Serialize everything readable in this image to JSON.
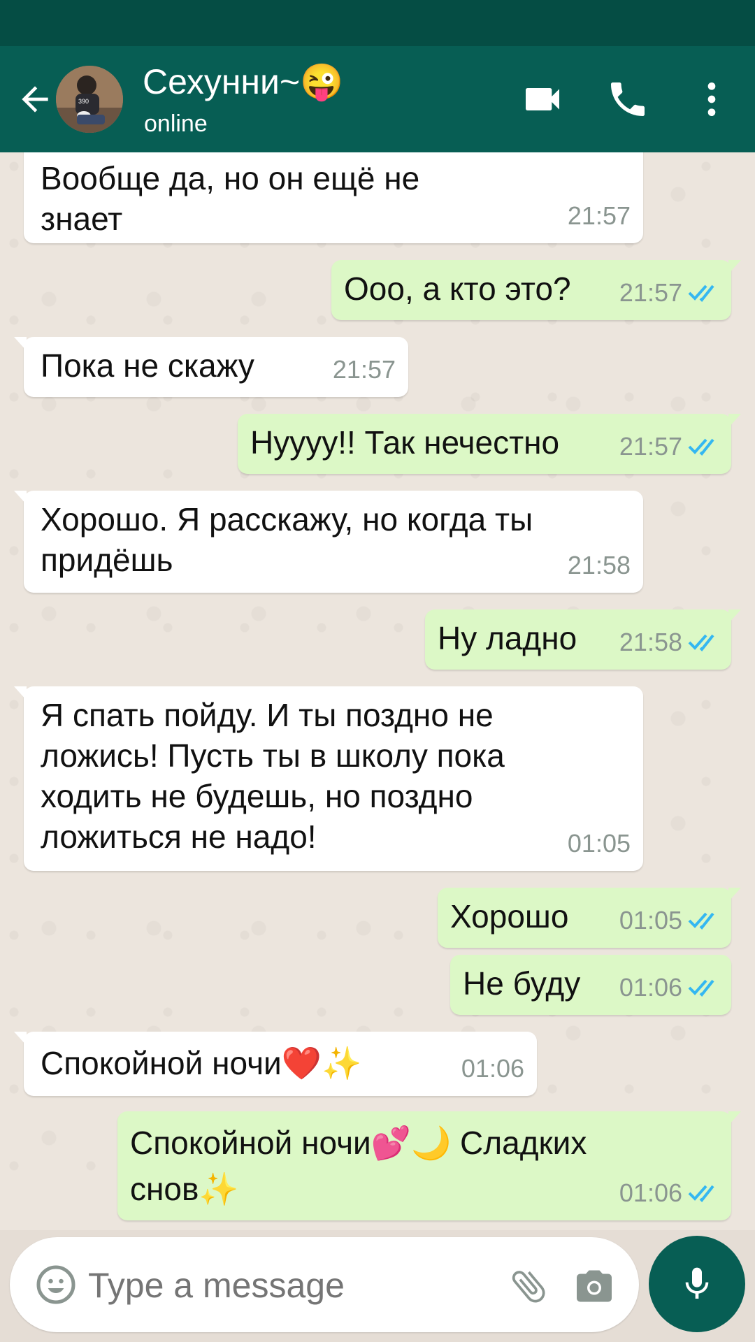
{
  "header": {
    "contact_name": "Сехунни~😜",
    "status": "online",
    "avatar_text": "390"
  },
  "messages": [
    {
      "dir": "in",
      "text": "Вообще да, но он ещё не\nзнает",
      "time": "21:57"
    },
    {
      "dir": "out",
      "text": "Ооо, а кто это?",
      "time": "21:57"
    },
    {
      "dir": "in",
      "text": "Пока не скажу",
      "time": "21:57"
    },
    {
      "dir": "out",
      "text": "Нуууу!! Так нечестно",
      "time": "21:57"
    },
    {
      "dir": "in",
      "text": "Хорошо. Я расскажу, но когда ты\nпридёшь",
      "time": "21:58"
    },
    {
      "dir": "out",
      "text": "Ну ладно",
      "time": "21:58"
    },
    {
      "dir": "in",
      "text": "Я спать пойду. И ты поздно не\nложись! Пусть ты в школу пока\nходить не будешь, но поздно\nложиться не надо!",
      "time": "01:05"
    },
    {
      "dir": "out",
      "text": "Хорошо",
      "time": "01:05"
    },
    {
      "dir": "out",
      "text": "Не буду",
      "time": "01:06"
    },
    {
      "dir": "in",
      "text": "Спокойной ночи❤️✨",
      "time": "01:06"
    },
    {
      "dir": "out",
      "text": "Спокойной ночи💕🌙 Сладких\nснов✨",
      "time": "01:06"
    }
  ],
  "composer": {
    "placeholder": "Type a message"
  },
  "colors": {
    "app_bar": "#075e54",
    "status_bar": "#054d44",
    "outgoing_bubble": "#dcf8c6",
    "incoming_bubble": "#ffffff",
    "read_ticks": "#34b7f1"
  },
  "icons": [
    "back-arrow-icon",
    "video-call-icon",
    "phone-icon",
    "more-vert-icon",
    "emoji-icon",
    "attach-icon",
    "camera-icon",
    "mic-icon",
    "double-tick-icon"
  ]
}
